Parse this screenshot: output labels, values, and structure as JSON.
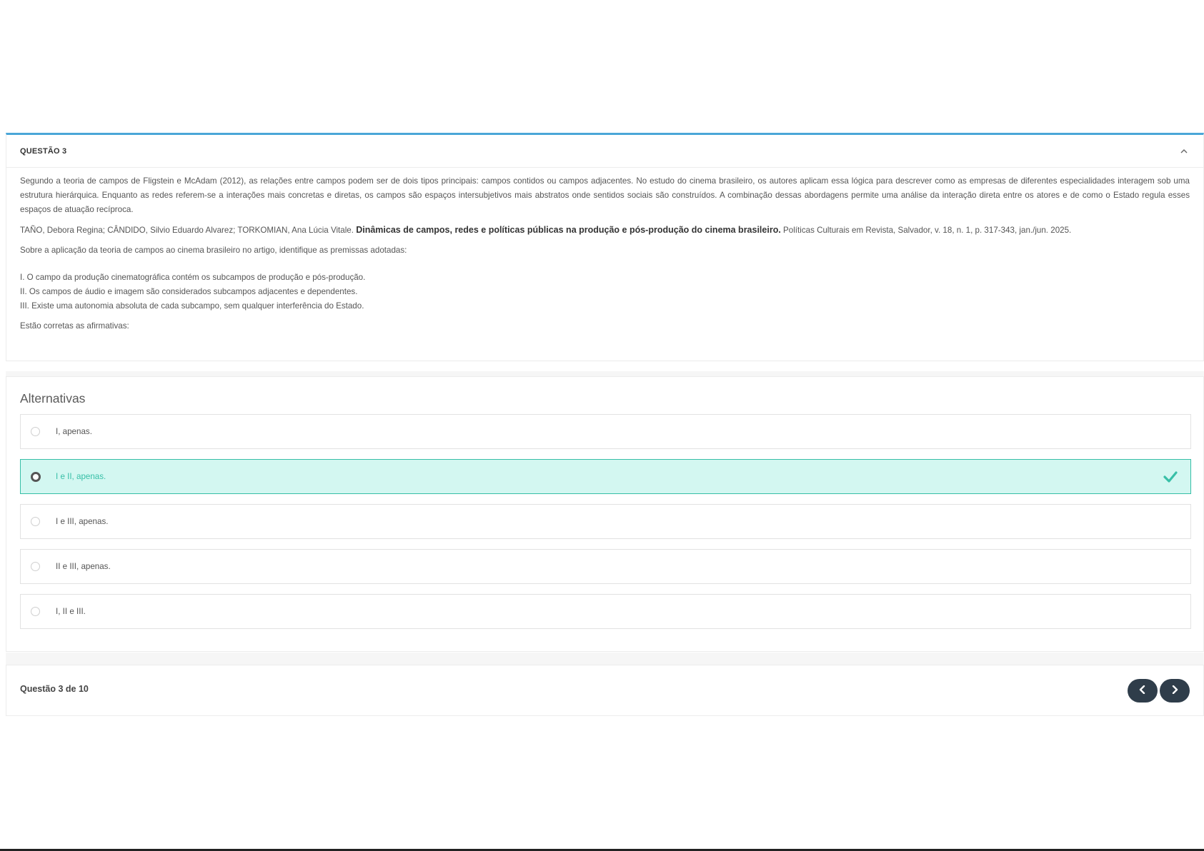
{
  "question": {
    "title": "QUESTÃO 3",
    "paragraph": "Segundo a teoria de campos de Fligstein e McAdam (2012), as relações entre campos podem ser de dois tipos principais: campos contidos ou campos adjacentes. No estudo do cinema brasileiro, os autores aplicam essa lógica para descrever como as empresas de diferentes especialidades interagem sob uma estrutura hierárquica. Enquanto as redes referem-se a interações mais concretas e diretas, os campos são espaços intersubjetivos mais abstratos onde sentidos sociais são construídos. A combinação dessas abordagens permite uma análise da interação direta entre os atores e de como o Estado regula esses espaços de atuação recíproca.",
    "reference_authors": "TAÑO, Debora Regina; CÂNDIDO, Silvio Eduardo Alvarez; TORKOMIAN, Ana Lúcia Vitale.",
    "reference_title": "Dinâmicas de campos, redes e políticas públicas na produção e pós-produção do cinema brasileiro.",
    "reference_source": "Políticas Culturais em Revista, Salvador, v. 18, n. 1, p. 317-343, jan./jun. 2025.",
    "prompt": "Sobre a aplicação da teoria de campos ao cinema brasileiro no artigo, identifique as premissas adotadas:",
    "premises": [
      "I. O campo da produção cinematográfica contém os subcampos de produção e pós-produção.",
      "II. Os campos de áudio e imagem são considerados subcampos adjacentes e dependentes.",
      "III. Existe uma autonomia absoluta de cada subcampo, sem qualquer interferência do Estado."
    ],
    "closing": "Estão corretas as afirmativas:"
  },
  "alternatives": {
    "title": "Alternativas",
    "items": [
      {
        "label": "I, apenas.",
        "selected": false
      },
      {
        "label": "I e II, apenas.",
        "selected": true
      },
      {
        "label": "I e III, apenas.",
        "selected": false
      },
      {
        "label": "II e III, apenas.",
        "selected": false
      },
      {
        "label": "I, II e III.",
        "selected": false
      }
    ]
  },
  "footer": {
    "pager": "Questão 3 de 10"
  },
  "colors": {
    "accent_top_border": "#4aa6d8",
    "selected_bg": "#d3f7f1",
    "selected_accent": "#37bfa7",
    "nav_button": "#2f3d4a"
  },
  "icons": {
    "collapse": "chevron-up-icon",
    "selected": "checkmark-icon",
    "prev": "chevron-left-icon",
    "next": "chevron-right-icon"
  }
}
